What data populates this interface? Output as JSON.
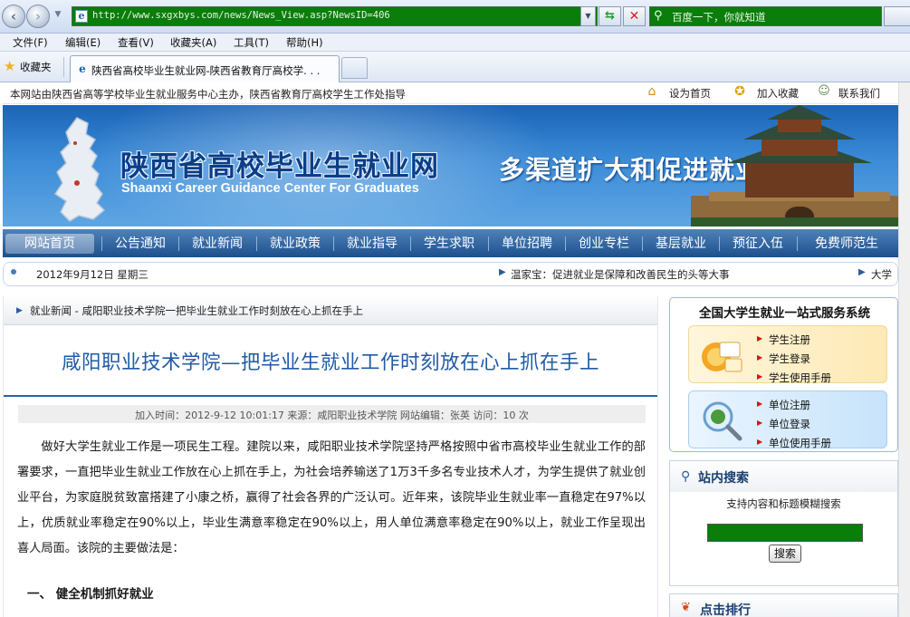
{
  "browser": {
    "url": "http://www.sxgxbys.com/news/News_View.asp?NewsID=406",
    "search_placeholder": "百度一下，你就知道",
    "menu": [
      "文件(F)",
      "编辑(E)",
      "查看(V)",
      "收藏夹(A)",
      "工具(T)",
      "帮助(H)"
    ],
    "favorites_label": "收藏夹",
    "tab_title": "陕西省高校毕业生就业网-陕西省教育厅高校学. . ."
  },
  "top_info": {
    "sponsor_text": "本网站由陕西省高等学校毕业生就业服务中心主办，陕西省教育厅高校学生工作处指导",
    "set_home": "设为首页",
    "add_fav": "加入收藏",
    "contact": "联系我们"
  },
  "banner": {
    "title": "陕西省高校毕业生就业网",
    "subtitle": "Shaanxi Career Guidance Center For Graduates",
    "slogan": "多渠道扩大和促进就业"
  },
  "nav": [
    "网站首页",
    "公告通知",
    "就业新闻",
    "就业政策",
    "就业指导",
    "学生求职",
    "单位招聘",
    "创业专栏",
    "基层就业",
    "预征入伍",
    "免费师范生"
  ],
  "datebar": {
    "date": "2012年9月12日 星期三",
    "ticker_1": "温家宝：促进就业是保障和改善民生的头等大事",
    "ticker_2": "大学"
  },
  "article": {
    "breadcrumb": "就业新闻 - 咸阳职业技术学院一把毕业生就业工作时刻放在心上抓在手上",
    "title": "咸阳职业技术学院—把毕业生就业工作时刻放在心上抓在手上",
    "meta": "加入时间：2012-9-12 10:01:17   来源：咸阳职业技术学院   网站编辑：张英   访问：10 次",
    "body": "做好大学生就业工作是一项民生工程。建院以来，咸阳职业技术学院坚持严格按照中省市高校毕业生就业工作的部署要求，一直把毕业生就业工作放在心上抓在手上，为社会培养输送了1万3千多名专业技术人才，为学生提供了就业创业平台，为家庭脱贫致富搭建了小康之桥，赢得了社会各界的广泛认可。近年来，该院毕业生就业率一直稳定在97%以上，优质就业率稳定在90%以上，毕业生满意率稳定在90%以上，用人单位满意率稳定在90%以上，就业工作呈现出喜人局面。该院的主要做法是：",
    "section_heading": "一、  健全机制抓好就业"
  },
  "sidebar": {
    "service_title": "全国大学生就业一站式服务系统",
    "student_links": [
      "学生注册",
      "学生登录",
      "学生使用手册"
    ],
    "unit_links": [
      "单位注册",
      "单位登录",
      "单位使用手册"
    ],
    "search_title": "站内搜索",
    "search_hint": "支持内容和标题模糊搜索",
    "search_button": "搜索",
    "rank_title": "点击排行"
  },
  "colors": {
    "nav_blue": "#1d4f8d",
    "title_blue": "#1f5aa6",
    "input_green": "#0a7d0a"
  }
}
